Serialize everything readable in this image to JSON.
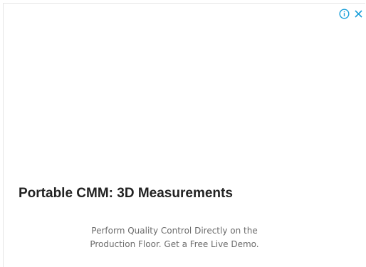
{
  "ad": {
    "headline": "Portable CMM: 3D Measurements",
    "description_lines": [
      "Perform Quality Control Directly on the",
      "Production Floor. Get a Free Live Demo."
    ],
    "controls": {
      "info_icon": "info-icon",
      "close_icon": "close-icon",
      "accent_color": "#1a9fd9"
    }
  }
}
